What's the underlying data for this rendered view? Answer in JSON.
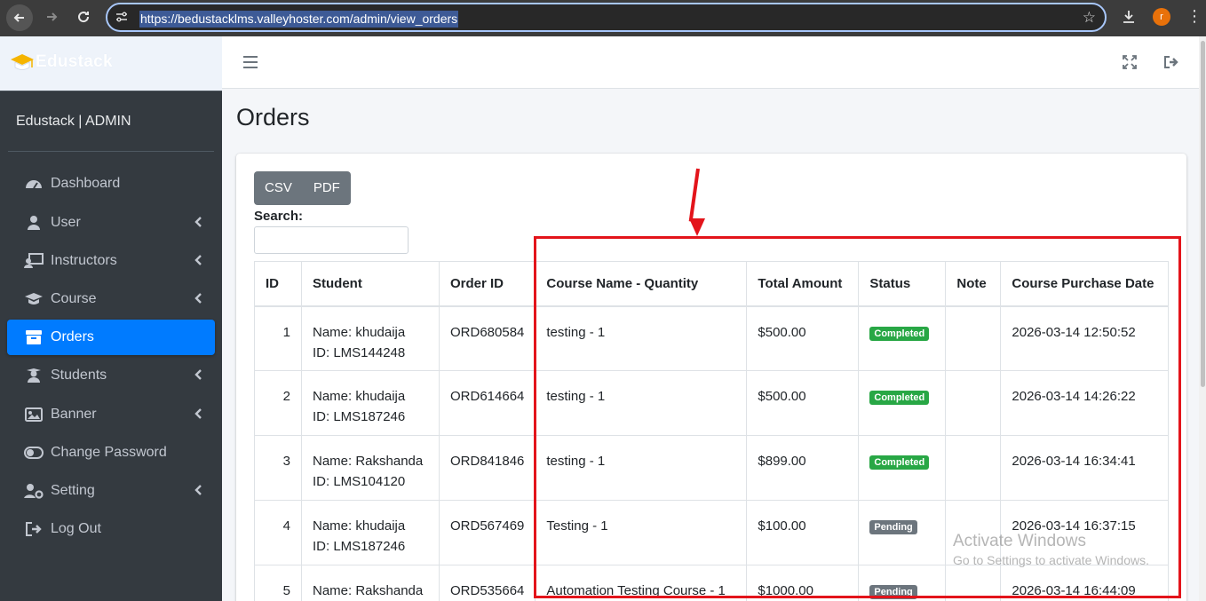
{
  "browser": {
    "url": "https://bedustacklms.valleyhoster.com/admin/view_orders",
    "profile_initial": "r"
  },
  "sidebar": {
    "brand": "Edustack",
    "admin_label": "Edustack | ADMIN",
    "items": [
      {
        "label": "Dashboard",
        "icon": "dashboard-icon",
        "caret": false,
        "active": false
      },
      {
        "label": "User",
        "icon": "user-icon",
        "caret": true,
        "active": false
      },
      {
        "label": "Instructors",
        "icon": "instructor-icon",
        "caret": true,
        "active": false
      },
      {
        "label": "Course",
        "icon": "graduation-cap-icon",
        "caret": true,
        "active": false
      },
      {
        "label": "Orders",
        "icon": "box-icon",
        "caret": false,
        "active": true
      },
      {
        "label": "Students",
        "icon": "student-icon",
        "caret": true,
        "active": false
      },
      {
        "label": "Banner",
        "icon": "image-icon",
        "caret": true,
        "active": false
      },
      {
        "label": "Change Password",
        "icon": "toggle-icon",
        "caret": false,
        "active": false
      },
      {
        "label": "Setting",
        "icon": "user-cog-icon",
        "caret": true,
        "active": false
      },
      {
        "label": "Log Out",
        "icon": "logout-icon",
        "caret": false,
        "active": false
      }
    ]
  },
  "main": {
    "title": "Orders",
    "buttons": {
      "csv": "CSV",
      "pdf": "PDF"
    },
    "search_label": "Search:",
    "search_value": "",
    "table": {
      "headers": [
        "ID",
        "Student",
        "Order ID",
        "Course Name - Quantity",
        "Total Amount",
        "Status",
        "Note",
        "Course Purchase Date"
      ],
      "rows": [
        {
          "id": "1",
          "name": "Name: khudaija",
          "sid": "ID: LMS144248",
          "order": "ORD680584",
          "course": "testing - 1",
          "amount": "$500.00",
          "status": "Completed",
          "note": "",
          "date": "2026-03-14 12:50:52"
        },
        {
          "id": "2",
          "name": "Name: khudaija",
          "sid": "ID: LMS187246",
          "order": "ORD614664",
          "course": "testing - 1",
          "amount": "$500.00",
          "status": "Completed",
          "note": "",
          "date": "2026-03-14 14:26:22"
        },
        {
          "id": "3",
          "name": "Name: Rakshanda",
          "sid": "ID: LMS104120",
          "order": "ORD841846",
          "course": "testing - 1",
          "amount": "$899.00",
          "status": "Completed",
          "note": "",
          "date": "2026-03-14 16:34:41"
        },
        {
          "id": "4",
          "name": "Name: khudaija",
          "sid": "ID: LMS187246",
          "order": "ORD567469",
          "course": "Testing - 1",
          "amount": "$100.00",
          "status": "Pending",
          "note": "",
          "date": "2026-03-14 16:37:15"
        },
        {
          "id": "5",
          "name": "Name: Rakshanda",
          "sid": "",
          "order": "ORD535664",
          "course": "Automation Testing Course - 1",
          "amount": "$1000.00",
          "status": "Pending",
          "note": "",
          "date": "2026-03-14 16:44:09"
        }
      ]
    }
  },
  "watermark": {
    "line1": "Activate Windows",
    "line2": "Go to Settings to activate Windows."
  },
  "colors": {
    "sidebar_bg": "#343a40",
    "active_item": "#007bff",
    "completed": "#28a745",
    "pending": "#6c757d",
    "annotation": "#e3141b"
  }
}
